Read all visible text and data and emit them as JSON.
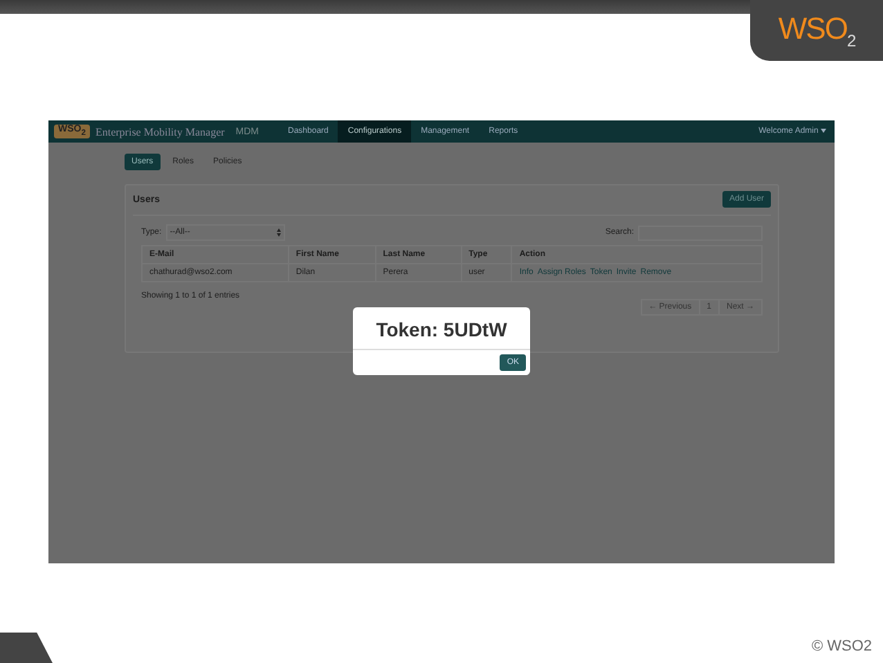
{
  "slide": {
    "logo": "WSO$_{2}$",
    "copyright": "© WSO2"
  },
  "navbar": {
    "logo": "WSO$_{2}$",
    "title": "Enterprise Mobility Manager",
    "subtitle": "MDM",
    "items": [
      {
        "label": "Dashboard",
        "selected": false
      },
      {
        "label": "Configurations",
        "selected": true
      },
      {
        "label": "Management",
        "selected": false
      },
      {
        "label": "Reports",
        "selected": false
      }
    ],
    "user_menu": "Welcome Admin"
  },
  "subnav": [
    {
      "label": "Users",
      "selected": true
    },
    {
      "label": "Roles",
      "selected": false
    },
    {
      "label": "Policies",
      "selected": false
    }
  ],
  "panel": {
    "title": "Users",
    "add_button": "Add User",
    "type_label": "Type:",
    "type_value": "--All--",
    "search_label": "Search:",
    "columns": [
      "E-Mail",
      "First Name",
      "Last Name",
      "Type",
      "Action"
    ],
    "rows": [
      {
        "cells": [
          "chathurad@wso2.com",
          "Dilan",
          "Perera",
          "user"
        ],
        "actions": [
          "Info",
          "Assign Roles",
          "Token",
          "Invite",
          "Remove"
        ]
      }
    ],
    "info": "Showing 1 to 1 of 1 entries",
    "pagination": [
      "← Previous",
      "1",
      "Next →"
    ]
  },
  "modal": {
    "title": "Token: 5UDtW",
    "button": "OK"
  }
}
